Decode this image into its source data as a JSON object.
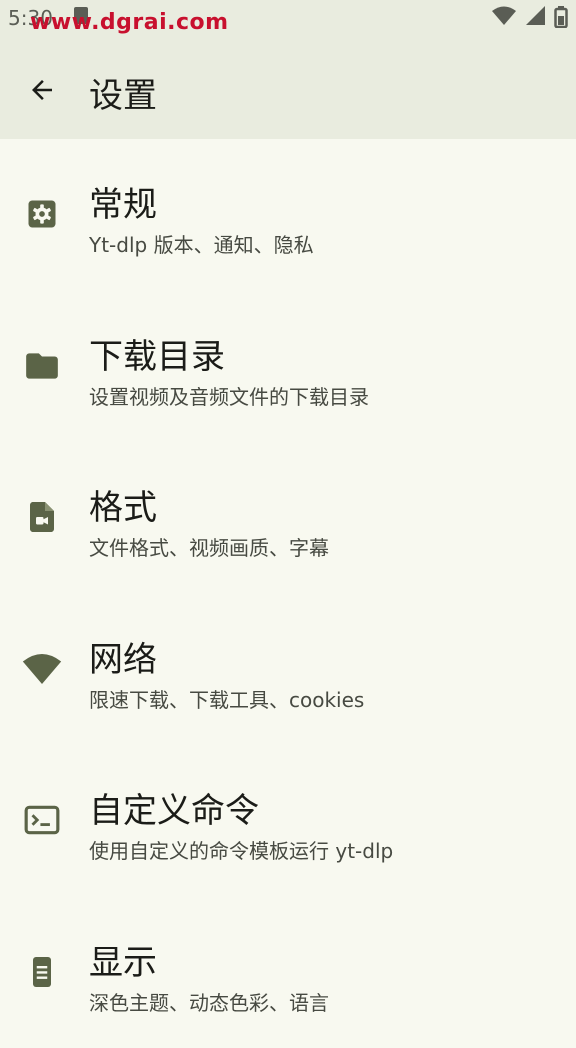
{
  "status_bar": {
    "time": "5:30",
    "watermark": "www.dgrai.com"
  },
  "app_bar": {
    "title": "设置"
  },
  "colors": {
    "icon": "#5b6447",
    "background": "#f8f9f0",
    "app_bar": "#e9ecdf"
  },
  "settings": [
    {
      "icon": "settings-gear-icon",
      "title": "常规",
      "subtitle": "Yt-dlp 版本、通知、隐私"
    },
    {
      "icon": "folder-icon",
      "title": "下载目录",
      "subtitle": "设置视频及音频文件的下载目录"
    },
    {
      "icon": "video-file-icon",
      "title": "格式",
      "subtitle": "文件格式、视频画质、字幕"
    },
    {
      "icon": "wifi-icon",
      "title": "网络",
      "subtitle": "限速下载、下载工具、cookies"
    },
    {
      "icon": "terminal-icon",
      "title": "自定义命令",
      "subtitle": "使用自定义的命令模板运行 yt-dlp"
    },
    {
      "icon": "display-icon",
      "title": "显示",
      "subtitle": "深色主题、动态色彩、语言"
    }
  ]
}
